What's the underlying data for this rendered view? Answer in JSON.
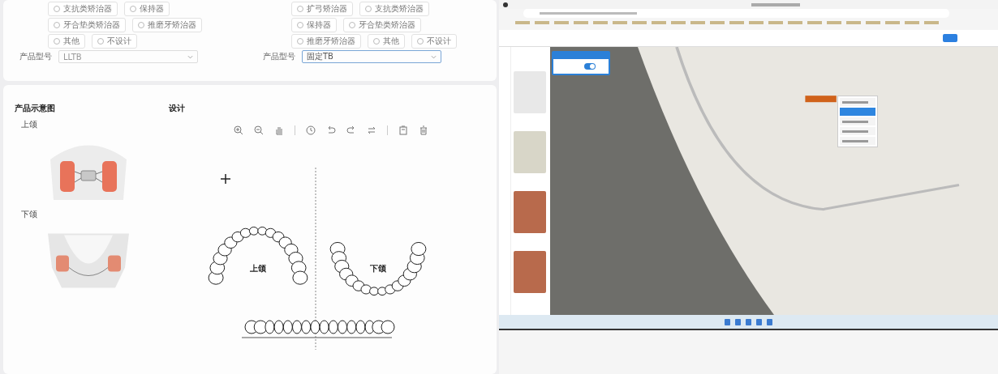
{
  "product_form": {
    "columns": [
      {
        "rows": [
          [
            {
              "label": "支抗类矫治器",
              "selected": false
            },
            {
              "label": "保持器",
              "selected": false
            }
          ],
          [
            {
              "label": "牙合垫类矫治器",
              "selected": false
            },
            {
              "label": "推磨牙矫治器",
              "selected": false
            }
          ],
          [
            {
              "label": "其他",
              "selected": false
            },
            {
              "label": "不设计",
              "selected": false
            }
          ]
        ],
        "field": {
          "label": "产品型号",
          "value": "LLTB",
          "focused": false
        }
      },
      {
        "rows": [
          [
            {
              "label": "扩弓矫治器",
              "selected": false
            },
            {
              "label": "支抗类矫治器",
              "selected": false
            }
          ],
          [
            {
              "label": "保持器",
              "selected": false
            },
            {
              "label": "牙合垫类矫治器",
              "selected": false
            }
          ],
          [
            {
              "label": "推磨牙矫治器",
              "selected": false
            },
            {
              "label": "其他",
              "selected": false
            },
            {
              "label": "不设计",
              "selected": false
            }
          ]
        ],
        "field": {
          "label": "产品型号",
          "value": "固定TB",
          "focused": true
        }
      }
    ]
  },
  "preview": {
    "title": "产品示意图",
    "upper_label": "上颌",
    "lower_label": "下颌"
  },
  "design": {
    "title": "设计",
    "upper_label": "上颌",
    "lower_label": "下颌"
  },
  "app_window": {
    "panel_toggle": {
      "on": true
    },
    "context_menu": {
      "items": [
        {
          "selected": false
        },
        {
          "selected": true
        },
        {
          "selected": false
        },
        {
          "selected": false
        },
        {
          "selected": false
        }
      ]
    }
  }
}
